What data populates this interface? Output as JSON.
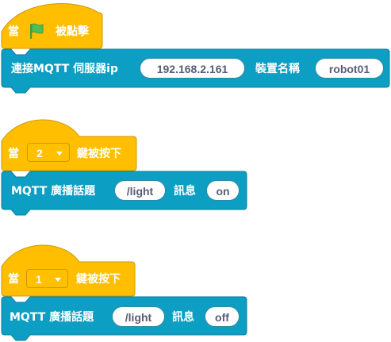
{
  "colors": {
    "event_fill": "#ffbf00",
    "event_stroke": "#cc9900",
    "mqtt_fill": "#0d9ec4",
    "mqtt_stroke": "#0b7e9c",
    "flag": "#4cbf56"
  },
  "script1": {
    "hat": {
      "when": "當",
      "flag_icon": "green-flag-icon",
      "clicked": "被點擊"
    },
    "connect": {
      "label": "連接MQTT 伺服器ip",
      "ip": "192.168.2.161",
      "device_label": "裝置名稱",
      "device_name": "robot01"
    }
  },
  "script2": {
    "hat": {
      "when": "當",
      "key": "2",
      "pressed": "鍵被按下"
    },
    "publish": {
      "label": "MQTT 廣播話題",
      "topic": "/light",
      "message_label": "訊息",
      "message": "on"
    }
  },
  "script3": {
    "hat": {
      "when": "當",
      "key": "1",
      "pressed": "鍵被按下"
    },
    "publish": {
      "label": "MQTT 廣播話題",
      "topic": "/light",
      "message_label": "訊息",
      "message": "off"
    }
  }
}
